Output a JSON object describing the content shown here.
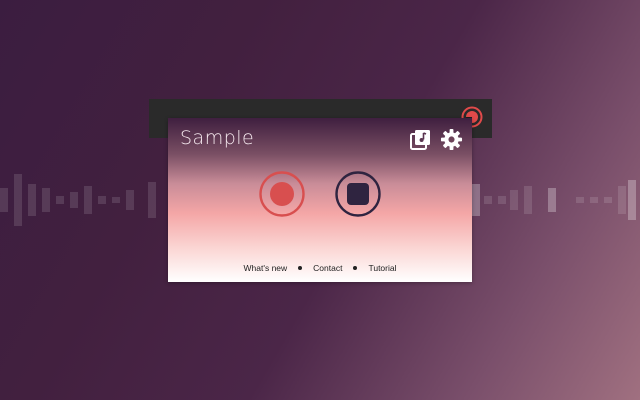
{
  "popup": {
    "title": "Sample",
    "icons": {
      "library": "music-library-icon",
      "settings": "gear-icon",
      "record": "record-icon",
      "stop": "stop-icon",
      "extension": "record-extension-icon"
    },
    "footer_links": [
      "What's new",
      "Contact",
      "Tutorial"
    ]
  },
  "colors": {
    "record": "#d84f4f",
    "stop": "#2f2440",
    "title": "#f5e8ee",
    "browser_bar": "#2a2a2a"
  }
}
